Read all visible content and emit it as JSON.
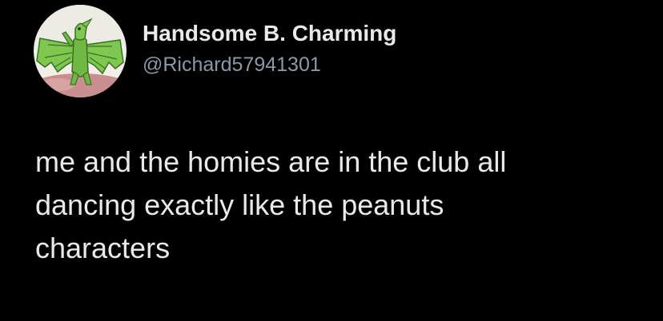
{
  "author": {
    "display_name": "Handsome B. Charming",
    "handle": "@Richard57941301",
    "avatar_icon": "green-dragon-avatar-icon"
  },
  "tweet": {
    "lines": [
      "me and the homies are in the club all",
      "dancing exactly like the peanuts",
      "characters"
    ]
  },
  "colors": {
    "background": "#000000",
    "primary_text": "#e7e9ea",
    "secondary_text": "#8b98a5"
  }
}
